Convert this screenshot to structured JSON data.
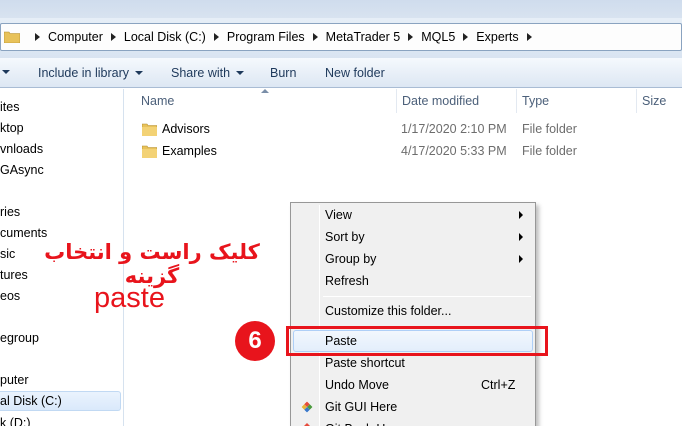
{
  "address": {
    "crumbs": [
      "Computer",
      "Local Disk (C:)",
      "Program Files",
      "MetaTrader 5",
      "MQL5",
      "Experts"
    ]
  },
  "toolbar": {
    "include_label": "Include in library",
    "share_label": "Share with",
    "burn_label": "Burn",
    "new_folder_label": "New folder"
  },
  "nav": {
    "items": [
      "ites",
      "ktop",
      "vnloads",
      "GAsync",
      "ries",
      "cuments",
      "sic",
      "tures",
      "eos",
      "egroup",
      "puter",
      "al Disk (C:)",
      "k (D:)"
    ]
  },
  "columns": {
    "name": "Name",
    "date": "Date modified",
    "type": "Type",
    "size": "Size"
  },
  "files": [
    {
      "name": "Advisors",
      "date": "1/17/2020 2:10 PM",
      "type": "File folder"
    },
    {
      "name": "Examples",
      "date": "4/17/2020 5:33 PM",
      "type": "File folder"
    }
  ],
  "annotation": {
    "instruction_fa": "کلیک راست و انتخاب گزینه",
    "instruction_word": "paste",
    "step_number": "6"
  },
  "menu": {
    "view": "View",
    "sort_by": "Sort by",
    "group_by": "Group by",
    "refresh": "Refresh",
    "customize": "Customize this folder...",
    "paste": "Paste",
    "paste_shortcut": "Paste shortcut",
    "undo_move": "Undo Move",
    "undo_shortcut": "Ctrl+Z",
    "git_gui": "Git GUI Here",
    "git_bash": "Git Bash Here"
  },
  "colors": {
    "annotation_red": "#e8141c",
    "highlight_border": "#aecff7"
  }
}
